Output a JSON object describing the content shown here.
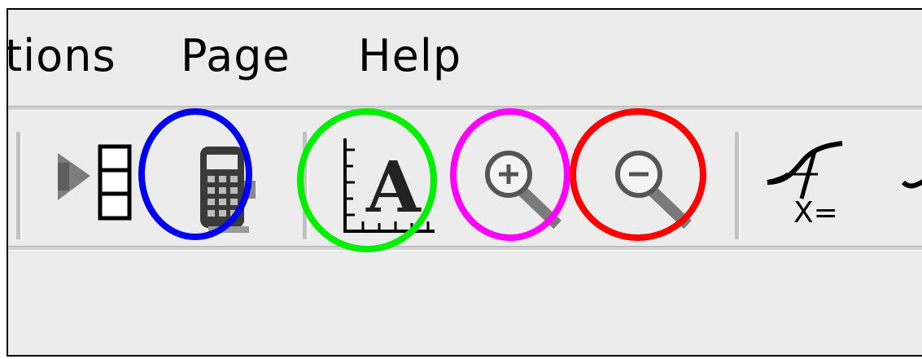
{
  "menubar": {
    "items": [
      {
        "label": "tions"
      },
      {
        "label": "Page"
      },
      {
        "label": "Help"
      }
    ]
  },
  "toolbar": {
    "tools": [
      {
        "icon": "run-table-icon"
      },
      {
        "icon": "calculator-icon",
        "highlight_color": "#0000ee"
      },
      {
        "icon": "axes-text-icon",
        "highlight_color": "#00ee00"
      },
      {
        "icon": "zoom-in-icon",
        "highlight_color": "#ff00ff"
      },
      {
        "icon": "zoom-out-icon",
        "highlight_color": "#ff0000"
      },
      {
        "icon": "solve-icon",
        "label": "X="
      }
    ]
  }
}
